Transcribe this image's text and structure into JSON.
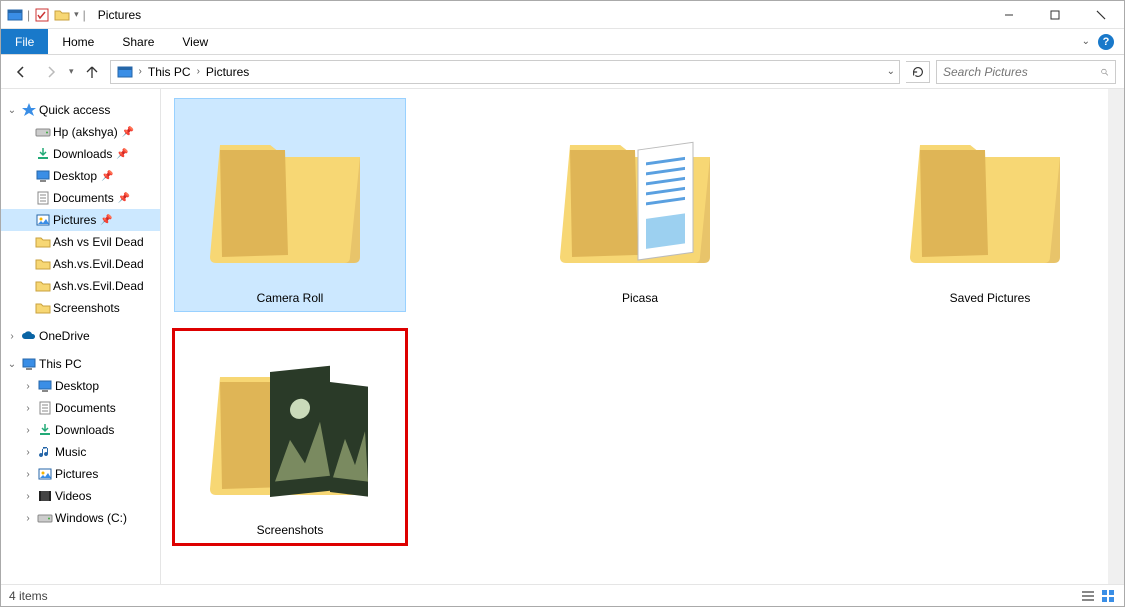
{
  "window": {
    "title": "Pictures"
  },
  "ribbon": {
    "file": "File",
    "tabs": [
      "Home",
      "Share",
      "View"
    ]
  },
  "breadcrumb": [
    "This PC",
    "Pictures"
  ],
  "search": {
    "placeholder": "Search Pictures"
  },
  "sidebar": {
    "quick_access": {
      "label": "Quick access",
      "items": [
        {
          "label": "Hp (akshya)",
          "pinned": true,
          "icon": "drive"
        },
        {
          "label": "Downloads",
          "pinned": true,
          "icon": "download"
        },
        {
          "label": "Desktop",
          "pinned": true,
          "icon": "desktop"
        },
        {
          "label": "Documents",
          "pinned": true,
          "icon": "doc"
        },
        {
          "label": "Pictures",
          "pinned": true,
          "icon": "pic",
          "selected": true
        },
        {
          "label": "Ash vs Evil Dead",
          "icon": "folder"
        },
        {
          "label": "Ash.vs.Evil.Dead",
          "icon": "folder"
        },
        {
          "label": "Ash.vs.Evil.Dead",
          "icon": "folder"
        },
        {
          "label": "Screenshots",
          "icon": "folder"
        }
      ]
    },
    "onedrive": {
      "label": "OneDrive"
    },
    "this_pc": {
      "label": "This PC",
      "items": [
        {
          "label": "Desktop",
          "icon": "desktop"
        },
        {
          "label": "Documents",
          "icon": "doc"
        },
        {
          "label": "Downloads",
          "icon": "download"
        },
        {
          "label": "Music",
          "icon": "music"
        },
        {
          "label": "Pictures",
          "icon": "pic"
        },
        {
          "label": "Videos",
          "icon": "video"
        },
        {
          "label": "Windows (C:)",
          "icon": "drive"
        }
      ]
    }
  },
  "folders": [
    {
      "label": "Camera Roll",
      "selected": true,
      "preview": "none"
    },
    {
      "label": "Picasa",
      "preview": "doc"
    },
    {
      "label": "Saved Pictures",
      "preview": "none"
    },
    {
      "label": "Screenshots",
      "preview": "img",
      "highlight": true
    }
  ],
  "status": {
    "count_label": "4 items"
  }
}
